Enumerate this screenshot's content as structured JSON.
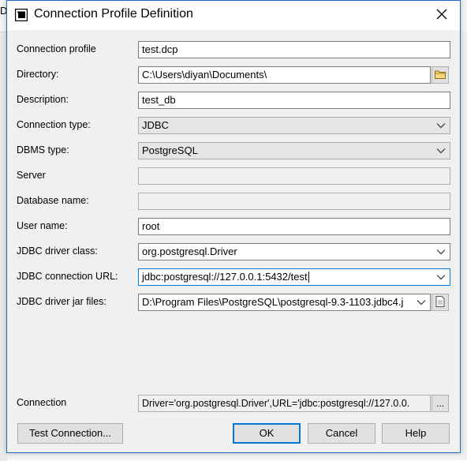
{
  "window": {
    "title": "Connection Profile Definition"
  },
  "background": {
    "partial_text": "D"
  },
  "fields": {
    "connection_profile": {
      "label": "Connection profile",
      "value": "test.dcp"
    },
    "directory": {
      "label": "Directory:",
      "value": "C:\\Users\\diyan\\Documents\\"
    },
    "description": {
      "label": "Description:",
      "value": "test_db"
    },
    "connection_type": {
      "label": "Connection type:",
      "value": "JDBC"
    },
    "dbms_type": {
      "label": "DBMS type:",
      "value": "PostgreSQL"
    },
    "server": {
      "label": "Server",
      "value": ""
    },
    "database_name": {
      "label": "Database name:",
      "value": ""
    },
    "user_name": {
      "label": "User name:",
      "value": "root"
    },
    "jdbc_driver_class": {
      "label": "JDBC driver class:",
      "value": "org.postgresql.Driver"
    },
    "jdbc_connection_url": {
      "label": "JDBC connection URL:",
      "value": "jdbc:postgresql://127.0.0.1:5432/test"
    },
    "jdbc_driver_jar_files": {
      "label": "JDBC driver jar files:",
      "value": "D:\\Program Files\\PostgreSQL\\postgresql-9.3-1103.jdbc4.j"
    },
    "connection": {
      "label": "Connection",
      "value": "Driver='org.postgresql.Driver',URL='jdbc:postgresql://127.0.0."
    }
  },
  "buttons": {
    "browse_directory": "folder-icon",
    "browse_jar": "file-icon",
    "connection_more": "...",
    "test_connection": "Test Connection...",
    "ok": "OK",
    "cancel": "Cancel",
    "help": "Help"
  },
  "colors": {
    "accent": "#0078d7",
    "border": "#1a6cc4",
    "dialog_bg": "#f0f0f0"
  }
}
